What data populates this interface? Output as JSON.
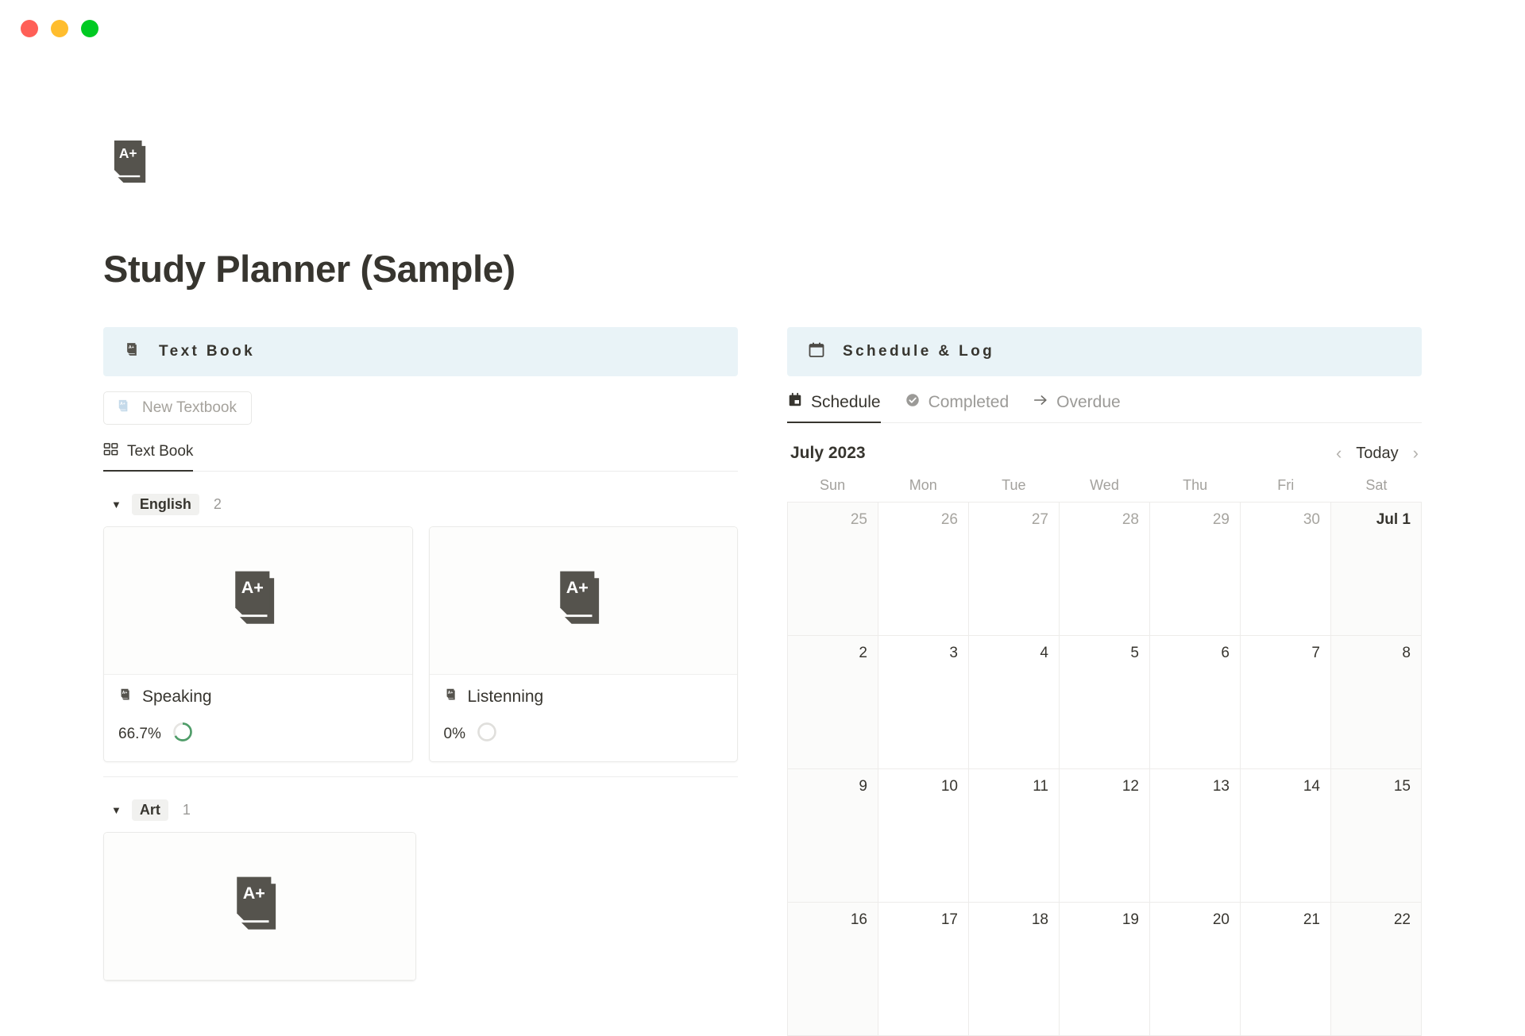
{
  "window": {
    "traffic_lights": [
      {
        "name": "close-button",
        "color": "#ff5f57"
      },
      {
        "name": "minimize-button",
        "color": "#ffbd2e"
      },
      {
        "name": "maximize-button",
        "color": "#00ca22"
      }
    ]
  },
  "doc": {
    "icon": "textbook-a-plus-icon",
    "title": "Study Planner (Sample)"
  },
  "textbook": {
    "callout_icon": "textbook-a-plus-icon",
    "callout_label": "Text Book",
    "new_button": {
      "icon": "textbook-a-plus-icon",
      "label": "New Textbook"
    },
    "tabs": [
      {
        "label": "Text Book",
        "icon": "gallery-grid-icon",
        "active": true
      }
    ],
    "groups": [
      {
        "name": "English",
        "count": "2",
        "caret": "▼",
        "cards": [
          {
            "title": "Speaking",
            "icon": "textbook-a-plus-icon",
            "thumb_icon": "textbook-a-plus-icon",
            "progress_label": "66.7%",
            "progress_value": 66.7,
            "progress_color": "#4f9d69"
          },
          {
            "title": "Listenning",
            "icon": "textbook-a-plus-icon",
            "thumb_icon": "textbook-a-plus-icon",
            "progress_label": "0%",
            "progress_value": 0,
            "progress_color": "#dddcd9"
          }
        ]
      },
      {
        "name": "Art",
        "count": "1",
        "caret": "▼",
        "cards": [
          {
            "title": "",
            "icon": "textbook-a-plus-icon",
            "thumb_icon": "textbook-a-plus-icon",
            "progress_label": "",
            "progress_value": 0,
            "progress_color": "#dddcd9"
          }
        ]
      }
    ]
  },
  "schedule": {
    "callout_icon": "calendar-icon",
    "callout_label": "Schedule & Log",
    "tabs": [
      {
        "label": "Schedule",
        "icon": "calendar-filled-icon",
        "active": true
      },
      {
        "label": "Completed",
        "icon": "check-circle-icon",
        "active": false
      },
      {
        "label": "Overdue",
        "icon": "arrow-right-icon",
        "active": false
      }
    ],
    "calendar": {
      "month_label": "July 2023",
      "prev_arrow": "‹",
      "today_label": "Today",
      "next_arrow": "›",
      "day_names": [
        "Sun",
        "Mon",
        "Tue",
        "Wed",
        "Thu",
        "Fri",
        "Sat"
      ],
      "weeks": [
        [
          {
            "label": "25",
            "muted": true,
            "emph": false
          },
          {
            "label": "26",
            "muted": true,
            "emph": false
          },
          {
            "label": "27",
            "muted": true,
            "emph": false
          },
          {
            "label": "28",
            "muted": true,
            "emph": false
          },
          {
            "label": "29",
            "muted": true,
            "emph": false
          },
          {
            "label": "30",
            "muted": true,
            "emph": false
          },
          {
            "label": "Jul 1",
            "muted": false,
            "emph": true
          }
        ],
        [
          {
            "label": "2",
            "muted": false,
            "emph": false
          },
          {
            "label": "3",
            "muted": false,
            "emph": false
          },
          {
            "label": "4",
            "muted": false,
            "emph": false
          },
          {
            "label": "5",
            "muted": false,
            "emph": false
          },
          {
            "label": "6",
            "muted": false,
            "emph": false
          },
          {
            "label": "7",
            "muted": false,
            "emph": false
          },
          {
            "label": "8",
            "muted": false,
            "emph": false
          }
        ],
        [
          {
            "label": "9",
            "muted": false,
            "emph": false
          },
          {
            "label": "10",
            "muted": false,
            "emph": false
          },
          {
            "label": "11",
            "muted": false,
            "emph": false
          },
          {
            "label": "12",
            "muted": false,
            "emph": false
          },
          {
            "label": "13",
            "muted": false,
            "emph": false
          },
          {
            "label": "14",
            "muted": false,
            "emph": false
          },
          {
            "label": "15",
            "muted": false,
            "emph": false
          }
        ],
        [
          {
            "label": "16",
            "muted": false,
            "emph": false
          },
          {
            "label": "17",
            "muted": false,
            "emph": false
          },
          {
            "label": "18",
            "muted": false,
            "emph": false
          },
          {
            "label": "19",
            "muted": false,
            "emph": false
          },
          {
            "label": "20",
            "muted": false,
            "emph": false
          },
          {
            "label": "21",
            "muted": false,
            "emph": false
          },
          {
            "label": "22",
            "muted": false,
            "emph": false
          }
        ]
      ]
    }
  },
  "colors": {
    "callout_bg": "#e9f3f7",
    "text": "#37352f",
    "muted": "#9b9a97",
    "accent_green": "#4f9d69"
  }
}
